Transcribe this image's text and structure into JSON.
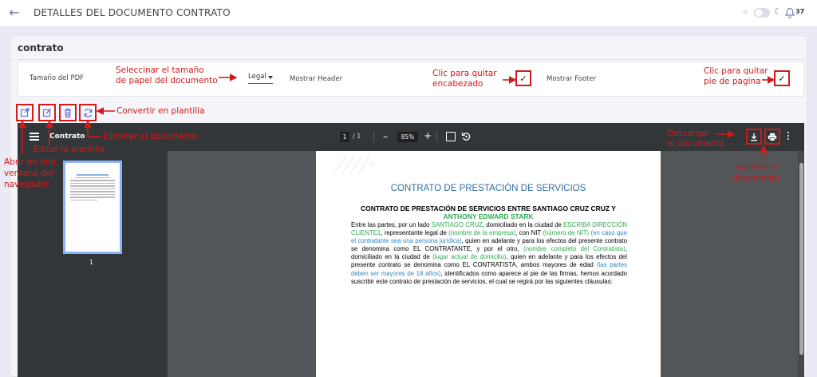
{
  "header": {
    "title": "DETALLES DEL DOCUMENTO CONTRATO",
    "notification_count": "37"
  },
  "card": {
    "title": "contrato",
    "pdf_size_label": "Tamaño del PDF",
    "pdf_size_value": "Legal",
    "show_header_label": "Mostrar Header",
    "show_footer_label": "Mostrar Footer",
    "show_header_checked": "✓",
    "show_footer_checked": "✓"
  },
  "viewer": {
    "doc_name": "Contrato",
    "current_page": "1",
    "page_total": "/ 1",
    "zoom": "85%",
    "thumb_number": "1"
  },
  "document": {
    "heading": "CONTRATO DE PRESTACIÓN DE SERVICIOS",
    "subheading": "CONTRATO DE PRESTACIÓN DE SERVICIOS ENTRE SANTIAGO CRUZ CRUZ  Y",
    "subheading_name": "ANTHONY EDWARD STARK",
    "body": [
      {
        "t": "Entre las partes, por un lado ",
        "c": ""
      },
      {
        "t": "SANTIAGO CRUZ",
        "c": "ph-green"
      },
      {
        "t": ", domiciliado en la ciudad de ",
        "c": ""
      },
      {
        "t": "ESCRIBA DIRECCIÓN CLIENTE1",
        "c": "ph-green"
      },
      {
        "t": ", representante legal de ",
        "c": ""
      },
      {
        "t": "(nombre de la empresa)",
        "c": "ph-green"
      },
      {
        "t": ", con NIT ",
        "c": ""
      },
      {
        "t": "(número de NIT)",
        "c": "ph-green"
      },
      {
        "t": " ",
        "c": ""
      },
      {
        "t": "(en caso que el contratante sea una persona jurídica)",
        "c": "ph-blue"
      },
      {
        "t": ", quien en adelante y para los efectos del presente contrato se denomina como EL CONTRATANTE, y por el otro, ",
        "c": ""
      },
      {
        "t": "(nombre completo del Contratista)",
        "c": "ph-green"
      },
      {
        "t": ", domiciliado en la ciudad de ",
        "c": ""
      },
      {
        "t": "(lugar actual de domicilio)",
        "c": "ph-green"
      },
      {
        "t": ", quien en adelante y para los efectos del presente contrato se denomina como EL CONTRATISTA, ambos mayores de edad ",
        "c": ""
      },
      {
        "t": "(las partes deben ser mayores de 18 años)",
        "c": "ph-blue"
      },
      {
        "t": ", identificados como aparece al pie de las firmas, hemos acordado suscribir este contrato de prestación de servicios, el cual se regirá por las siguientes cláusulas:",
        "c": ""
      }
    ]
  },
  "annotations": {
    "select_size": "Seleccinar el tamaño\nde papel del documento",
    "remove_header": "Clic para quitar\nencabezado",
    "remove_footer": "Clic para quitar\npie de pagina",
    "convert_template": "Convertir en plantilla",
    "delete_doc": "Eliminar el documento",
    "edit_template": "Editar la plantilla",
    "open_window": "Abrir en una\nventana del\nnavegador",
    "download_doc": "Descargar\nel documento",
    "print_doc": "Imprimir el\ndocumento"
  },
  "colors": {
    "annotation_red": "#d21a1a",
    "heading_blue": "#2f6fa5",
    "placeholder_green": "#33a852",
    "placeholder_blue": "#2f86c4",
    "viewer_toolbar": "#323639",
    "viewer_bg": "#525659",
    "toolbar_icon_purple": "#6b6fd0"
  },
  "icons": {
    "back": "arrow-left-icon",
    "theme_light": "sun-icon",
    "theme_dark": "moon-icon",
    "notifications": "bell-icon",
    "open": "external-link-icon",
    "edit": "edit-icon",
    "delete": "trash-icon",
    "convert": "refresh-icon",
    "menu": "hamburger-icon",
    "fit": "fit-page-icon",
    "rotate": "rotate-icon",
    "download": "download-icon",
    "print": "printer-icon",
    "more": "more-vertical-icon"
  }
}
